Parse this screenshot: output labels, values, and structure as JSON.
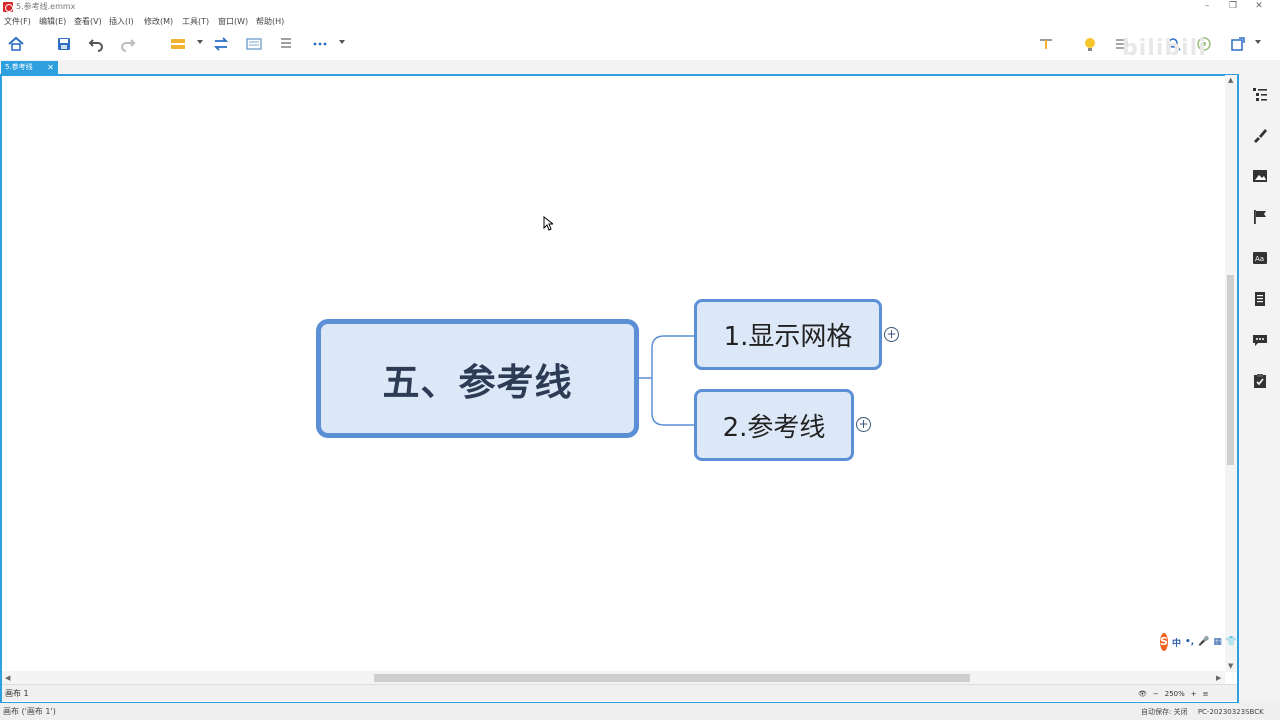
{
  "window": {
    "title": "5.参考线.emmx",
    "controls": [
      "minimize",
      "restore",
      "close"
    ]
  },
  "menu": {
    "items": [
      "文件(F)",
      "编辑(E)",
      "查看(V)",
      "插入(I)",
      "修改(M)",
      "工具(T)",
      "窗口(W)",
      "帮助(H)"
    ]
  },
  "toolbar": {
    "left_icons": [
      "home-icon",
      "save-icon",
      "undo-icon",
      "redo-icon",
      "style-icon",
      "swap-icon",
      "layout-icon",
      "outline-icon",
      "more-icon"
    ],
    "right_icons": [
      "relation-icon",
      "idea-icon",
      "summary-icon",
      "search-icon",
      "target-icon",
      "export-icon"
    ],
    "watermark": "bilibili"
  },
  "doc_tab": {
    "label": "5.参考线",
    "close": "✕"
  },
  "mindmap": {
    "central": "五、参考线",
    "topics": [
      "1.显示网格",
      "2.参考线"
    ],
    "expand_symbol": "+"
  },
  "sheet": {
    "tab_label": "画布 1"
  },
  "zoom": {
    "minus": "−",
    "value": "250%",
    "plus": "+"
  },
  "status": {
    "left": "画布 ('画布 1')",
    "autosave": "自动保存: 关闭",
    "machine": "PC-20230323SBCK"
  },
  "right_panel": {
    "icons": [
      "outline-panel-icon",
      "brush-icon",
      "image-icon",
      "flag-icon",
      "text-style-icon",
      "note-icon",
      "comment-icon",
      "task-icon"
    ]
  },
  "ime": {
    "logo": "S",
    "items": [
      "中",
      "•,",
      "🎤",
      "▦",
      "👕",
      "▦"
    ]
  },
  "colors": {
    "accent": "#2ea0e0",
    "topic_fill": "#dce8f7",
    "topic_border": "#5b8fd6",
    "central_text": "#2e3b55"
  }
}
